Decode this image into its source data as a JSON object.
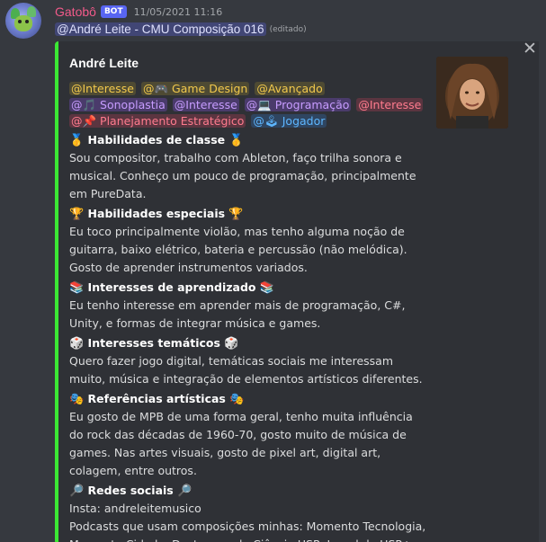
{
  "header": {
    "username": "Gatobô",
    "bot_tag": "BOT",
    "timestamp": "11/05/2021 11:16"
  },
  "message": {
    "mention": "@André Leite - CMU Composição 016",
    "edited": "(editado)"
  },
  "embed": {
    "accent_color": "#3be834",
    "author": "André Leite",
    "close_label": "✕",
    "roles": [
      {
        "label": "@Interesse",
        "color": "yellow"
      },
      {
        "label": "@🎮 Game Design",
        "color": "yellow"
      },
      {
        "label": "@Avançado",
        "color": "yellow"
      },
      {
        "label": "@🎵 Sonoplastia",
        "color": "purple"
      },
      {
        "label": "@Interesse",
        "color": "purple"
      },
      {
        "label": "@💻 Programação",
        "color": "purple"
      },
      {
        "label": "@Interesse",
        "color": "red"
      },
      {
        "label": "@📌 Planejamento Estratégico",
        "color": "red"
      },
      {
        "label": "@🕹 Jogador",
        "color": "blue"
      }
    ],
    "sections": [
      {
        "emoji": "🥇",
        "title": "Habilidades de classe",
        "body": "Sou compositor, trabalho com Ableton, faço trilha sonora e musical. Conheço um pouco de programação, principalmente em PureData."
      },
      {
        "emoji": "🏆",
        "title": "Habilidades especiais",
        "body": "Eu toco principalmente violão, mas tenho alguma noção de guitarra, baixo elétrico, bateria e percussão (não melódica). Gosto de aprender instrumentos variados."
      },
      {
        "emoji": "📚",
        "title": "Interesses de aprendizado",
        "body": "Eu tenho interesse em aprender mais de programação, C#, Unity, e formas de integrar música e games."
      },
      {
        "emoji": "🎲",
        "title": "Interesses temáticos",
        "body": "Quero fazer jogo digital, temáticas sociais me interessam muito, música e integração de elementos artísticos diferentes."
      },
      {
        "emoji": "🎭",
        "title": "Referências artísticas",
        "body": "Eu gosto de MPB de uma forma geral, tenho muita influência do rock das décadas de 1960-70, gosto muito de música de games. Nas artes visuais, gosto de pixel art, digital art, colagem, entre outros."
      },
      {
        "emoji": "🔎",
        "title": "Redes sociais",
        "body": "Insta: andreleitemusico\nPodcasts que usam composições minhas: Momento Tecnologia, Momento Cidade, Destaques do Ciência USP, Jornal da USP+"
      }
    ]
  }
}
